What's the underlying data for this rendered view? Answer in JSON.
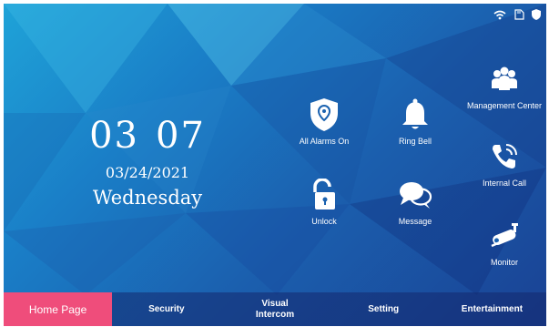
{
  "status": {
    "wifi_icon": "wifi-icon",
    "sd_icon": "sd-card-icon",
    "shield_icon": "shield-icon"
  },
  "clock": {
    "hour": "03",
    "minute": "07",
    "date": "03/24/2021",
    "weekday": "Wednesday"
  },
  "tiles": {
    "alarms": {
      "label": "All Alarms On",
      "icon": "alarm-shield-icon"
    },
    "ringbell": {
      "label": "Ring Bell",
      "icon": "bell-icon"
    },
    "unlock": {
      "label": "Unlock",
      "icon": "unlock-icon"
    },
    "message": {
      "label": "Message",
      "icon": "message-icon"
    },
    "management": {
      "label": "Management Center",
      "icon": "people-icon"
    },
    "internal": {
      "label": "Internal Call",
      "icon": "phone-icon"
    },
    "monitor": {
      "label": "Monitor",
      "icon": "camera-icon"
    }
  },
  "nav": {
    "home": "Home Page",
    "security": "Security",
    "visual_1": "Visual",
    "visual_2": "Intercom",
    "setting": "Setting",
    "entertainment": "Entertainment"
  },
  "colors": {
    "active_tab": "#ef4d7b",
    "background_top": "#1fa3d8",
    "background_bottom": "#1a4294"
  }
}
